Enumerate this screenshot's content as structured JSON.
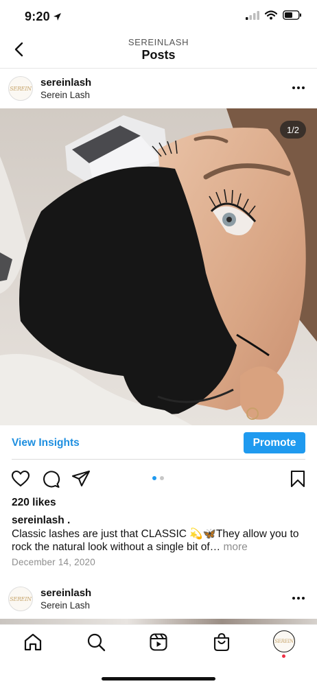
{
  "status_bar": {
    "time": "9:20"
  },
  "header": {
    "account": "SEREINLASH",
    "title": "Posts"
  },
  "post": {
    "username": "sereinlash",
    "display_name": "Serein Lash",
    "avatar_text": "SEREIN",
    "image_counter": "1/2",
    "view_insights": "View Insights",
    "promote": "Promote",
    "likes": "220 likes",
    "caption_username": "sereinlash .",
    "caption_text": "Classic lashes are just that CLASSIC 💫🦋They allow you to rock the natural look without a single bit of…",
    "caption_more": "more",
    "date": "December 14, 2020",
    "carousel": {
      "count": 2,
      "active_index": 0
    }
  },
  "next_post": {
    "username": "sereinlash",
    "display_name": "Serein Lash",
    "avatar_text": "SEREIN"
  },
  "colors": {
    "accent": "#1f9aef",
    "link": "#1e8fe0",
    "notification": "#ef2f44"
  },
  "icons": {
    "status": [
      "location-arrow-icon",
      "signal-icon",
      "wifi-icon",
      "battery-icon"
    ],
    "post_actions": [
      "heart-icon",
      "comment-icon",
      "share-icon",
      "bookmark-icon"
    ],
    "tabs": [
      "home-icon",
      "search-icon",
      "reels-icon",
      "shop-icon",
      "profile-icon"
    ]
  }
}
